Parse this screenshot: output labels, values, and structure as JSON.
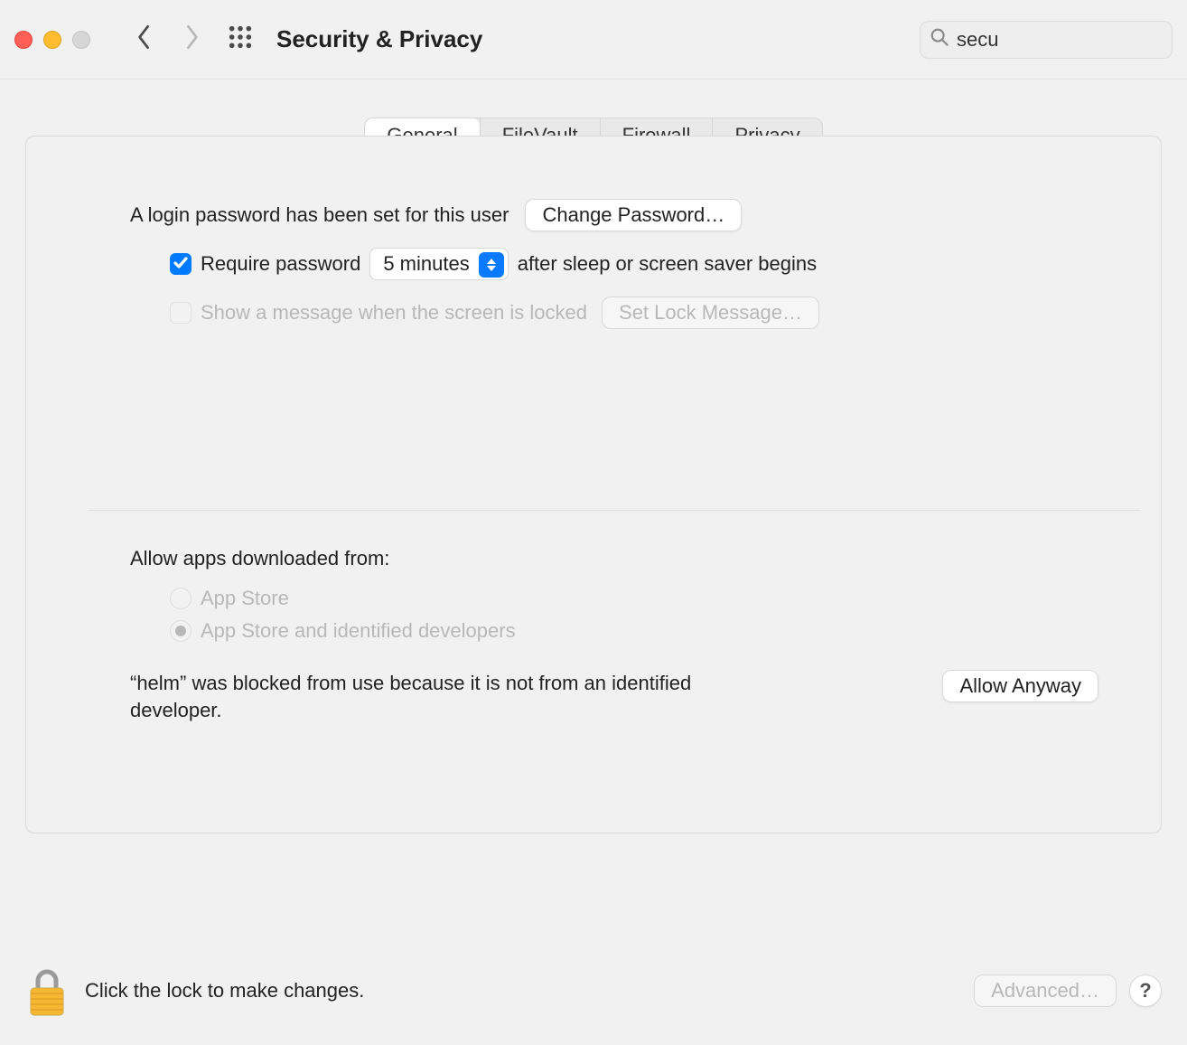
{
  "toolbar": {
    "title": "Security & Privacy",
    "search_value": "secu"
  },
  "tabs": {
    "general": "General",
    "filevault": "FileVault",
    "firewall": "Firewall",
    "privacy": "Privacy",
    "active": "general"
  },
  "general": {
    "login_password_text": "A login password has been set for this user",
    "change_password_btn": "Change Password…",
    "require_password_label_pre": "Require password",
    "require_password_delay": "5 minutes",
    "require_password_label_post": "after sleep or screen saver begins",
    "show_message_label": "Show a message when the screen is locked",
    "set_lock_message_btn": "Set Lock Message…",
    "allow_from_heading": "Allow apps downloaded from:",
    "radio_appstore": "App Store",
    "radio_identified": "App Store and identified developers",
    "blocked_message": "“helm” was blocked from use because it is not from an identified developer.",
    "allow_anyway_btn": "Allow Anyway"
  },
  "footer": {
    "lock_hint": "Click the lock to make changes.",
    "advanced_btn": "Advanced…",
    "help_btn": "?"
  }
}
